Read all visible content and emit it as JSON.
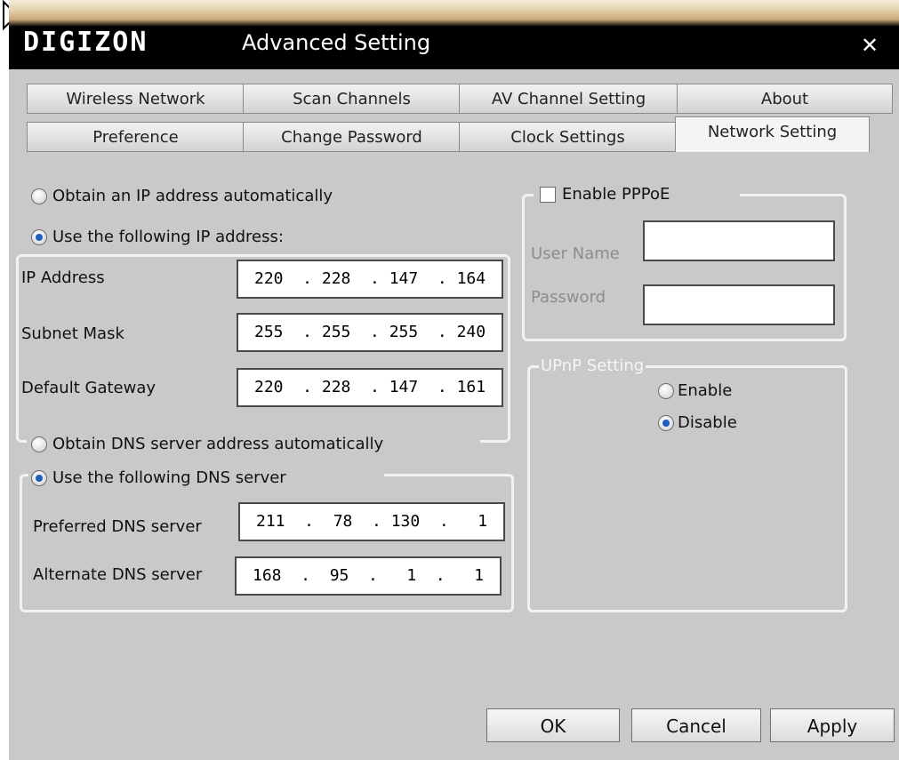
{
  "window": {
    "logo": "DIGIZON",
    "title": "Advanced Setting",
    "close_glyph": "✕"
  },
  "tabs": {
    "row1": [
      "Wireless Network",
      "Scan Channels",
      "AV Channel Setting",
      "About"
    ],
    "row2": [
      "Preference",
      "Change Password",
      "Clock Settings",
      "Network Setting"
    ],
    "active": "Network Setting"
  },
  "ip": {
    "auto_label": "Obtain an IP address automatically",
    "manual_label": "Use the following IP address:",
    "manual_selected": true,
    "ip_address_label": "IP Address",
    "ip_address": "220  . 228  . 147  . 164",
    "subnet_label": "Subnet Mask",
    "subnet": "255  . 255  . 255  . 240",
    "gateway_label": "Default Gateway",
    "gateway": "220  . 228  . 147  . 161"
  },
  "dns": {
    "auto_label": "Obtain DNS server address automatically",
    "manual_label": "Use the following DNS server",
    "manual_selected": true,
    "preferred_label": "Preferred DNS server",
    "preferred": "211  .  78  . 130  .   1",
    "alternate_label": "Alternate DNS server",
    "alternate": "168  .  95  .   1  .   1"
  },
  "pppoe": {
    "enable_label": "Enable PPPoE",
    "enabled": false,
    "username_label": "User Name",
    "password_label": "Password"
  },
  "upnp": {
    "title": "UPnP Setting",
    "enable_label": "Enable",
    "disable_label": "Disable",
    "selected": "Disable"
  },
  "buttons": {
    "ok": "OK",
    "cancel": "Cancel",
    "apply": "Apply"
  },
  "colors": {
    "background": "#c9c9c9",
    "titlebar": "#000000",
    "radio_dot": "#1f5fbf"
  }
}
